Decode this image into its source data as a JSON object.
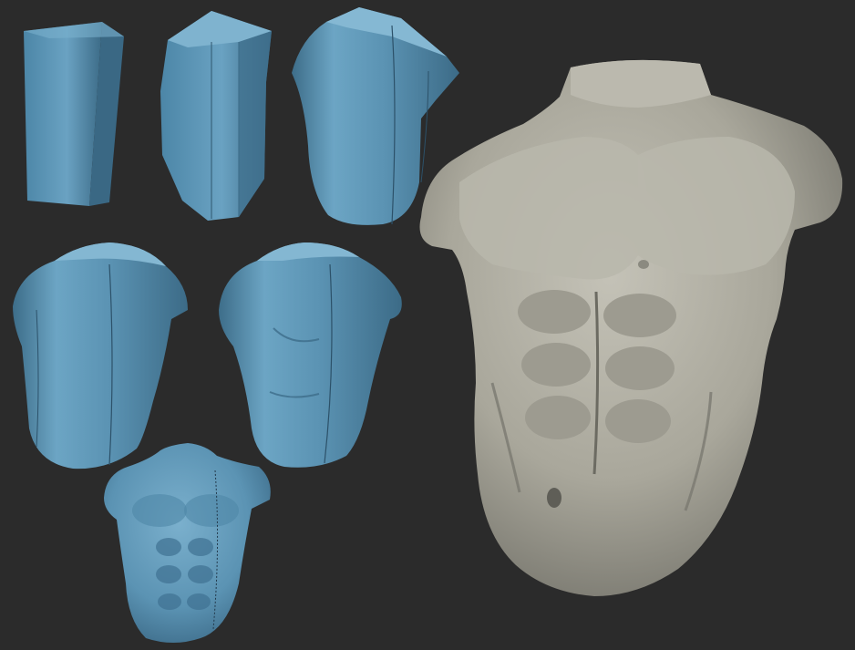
{
  "scene": {
    "background_color": "#2b2b2b",
    "model_colors": {
      "blockout": "#5b93b3",
      "blockout_light": "#79acc8",
      "blockout_dark": "#3f6f8c",
      "final_sculpt": "#a9a79b",
      "final_sculpt_light": "#c9c7bc",
      "final_sculpt_dark": "#77766c"
    },
    "stages": [
      {
        "name": "rectangular-block",
        "kind": "blockout"
      },
      {
        "name": "faceted-column",
        "kind": "blockout"
      },
      {
        "name": "rounded-column",
        "kind": "blockout"
      },
      {
        "name": "shoulder-blockout",
        "kind": "blockout"
      },
      {
        "name": "refined-blockout",
        "kind": "blockout"
      },
      {
        "name": "detailed-blue-torso",
        "kind": "blockout"
      },
      {
        "name": "final-grey-torso",
        "kind": "final"
      }
    ]
  }
}
